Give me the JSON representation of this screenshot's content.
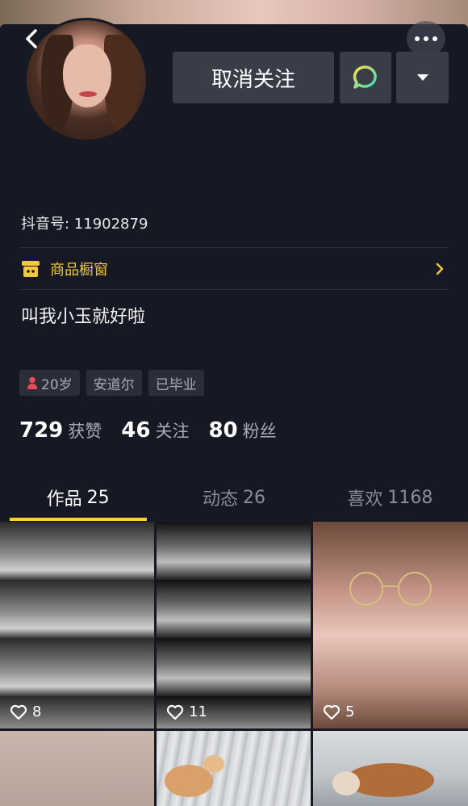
{
  "profile": {
    "douyin_id": "抖音号: 11902879",
    "bio": "叫我小玉就好啦",
    "tags": {
      "age": "20岁",
      "location": "安道尔",
      "school": "已毕业"
    }
  },
  "actions": {
    "unfollow_label": "取消关注",
    "message_icon": "chat-bubble-icon",
    "dropdown_icon": "caret-down-icon"
  },
  "shop": {
    "label": "商品橱窗"
  },
  "stats": [
    {
      "value": "729",
      "label": "获赞"
    },
    {
      "value": "46",
      "label": "关注"
    },
    {
      "value": "80",
      "label": "粉丝"
    }
  ],
  "tabs": [
    {
      "label": "作品",
      "count": "25",
      "active": true
    },
    {
      "label": "动态",
      "count": "26",
      "active": false
    },
    {
      "label": "喜欢",
      "count": "1168",
      "active": false
    }
  ],
  "videos": [
    {
      "likes": "8"
    },
    {
      "likes": "11"
    },
    {
      "likes": "5"
    }
  ],
  "colors": {
    "background": "#161823",
    "accent": "#f9d12a",
    "shop": "#f4c93c",
    "chat_icon": "#3ee4b0"
  }
}
